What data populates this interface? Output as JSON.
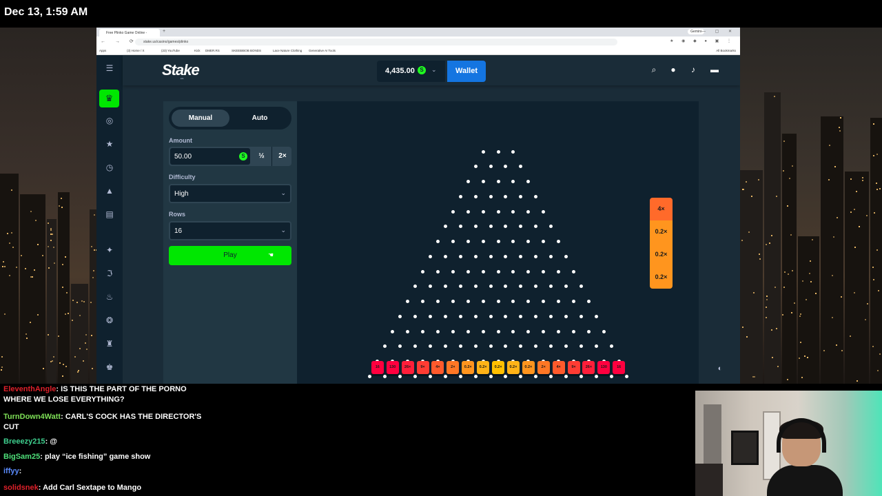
{
  "timestamp": "Dec 13, 1:59 AM",
  "browser": {
    "tab_title": "Free Plinko Game Online -",
    "url": "stake.us/casino/games/plinko",
    "profile_badge": "Gemini",
    "bookmarks": [
      "Apps",
      "(3) Home / X",
      "(23) YouTube",
      "Kick",
      "DMER.RS",
      "SKEEBIBOB BONDS",
      "Lace Nature Clothing",
      "Generative AI Tools"
    ],
    "all_bookmarks": "All Bookmarks"
  },
  "topnav": {
    "logo": "Stake",
    "logo_sub": ".us",
    "balance": "4,435.00",
    "currency_symbol": "S",
    "wallet_label": "Wallet"
  },
  "controls": {
    "mode_manual": "Manual",
    "mode_auto": "Auto",
    "amount_label": "Amount",
    "amount_value": "50.00",
    "half_label": "½",
    "double_label": "2×",
    "difficulty_label": "Difficulty",
    "difficulty_value": "High",
    "rows_label": "Rows",
    "rows_value": "16",
    "play_label": "Play"
  },
  "plinko": {
    "rows": 16,
    "multipliers": [
      "16",
      "130",
      "26×",
      "9×",
      "4×",
      "2×",
      "0.2×",
      "0.2×",
      "0.2×",
      "0.2×",
      "0.2×",
      "2×",
      "4×",
      "9×",
      "26×",
      "130",
      "16"
    ],
    "bucket_colors": [
      "#ff003f",
      "#ff003f",
      "#ff1e3a",
      "#ff3c33",
      "#ff5a2c",
      "#ff7725",
      "#ff951e",
      "#ffb317",
      "#ffc000",
      "#ffb317",
      "#ff951e",
      "#ff7725",
      "#ff5a2c",
      "#ff3c33",
      "#ff1e3a",
      "#ff003f",
      "#ff003f"
    ],
    "history": [
      "4×",
      "0.2×",
      "0.2×",
      "0.2×"
    ],
    "history_colors": [
      "#ff6a2a",
      "#ff951e",
      "#ff951e",
      "#ff951e"
    ]
  },
  "chat": [
    {
      "user": "EleventhAngle",
      "color": "#e0202a",
      "message": "IS THIS THE PART OF THE PORNO",
      "cont": "WHERE WE LOSE EVERYTHING?"
    },
    {
      "user": "TurnDown4Watt",
      "color": "#7ee057",
      "message": "CARL'S COCK HAS THE DIRECTOR'S",
      "cont": "CUT"
    },
    {
      "user": "Breeezy215",
      "color": "#3ecf8e",
      "message": "@",
      "cont": ""
    },
    {
      "user": "BigSam25",
      "color": "#4fe07a",
      "message": "play “ice fishing” game show",
      "cont": ""
    },
    {
      "user": "iffyy",
      "color": "#5b8cff",
      "message": "",
      "cont": ""
    },
    {
      "user": "solidsnek",
      "color": "#e0202a",
      "message": "Add Carl Sextape to Mango",
      "cont": ""
    }
  ]
}
